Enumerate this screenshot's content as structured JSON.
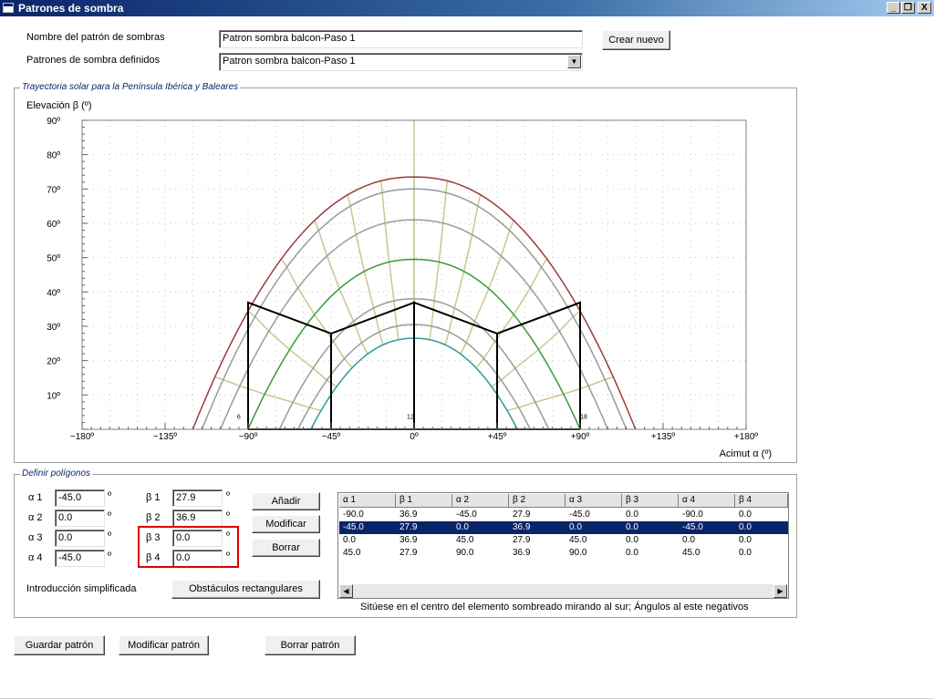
{
  "window": {
    "title": "Patrones de sombra",
    "buttons": [
      "_",
      "❐",
      "X"
    ]
  },
  "header": {
    "name_label": "Nombre del patrón de sombras",
    "name_value": "Patron sombra balcon-Paso 1",
    "defined_label": "Patrones de sombra definidos",
    "defined_value": "Patron sombra balcon-Paso 1",
    "create_button": "Crear nuevo"
  },
  "chart_group": {
    "title": "Trayectoria solar para la Península Ibérica y Baleares"
  },
  "chart_data": {
    "type": "line",
    "ylabel": "Elevación β (º)",
    "xlabel": "Acimut α (º)",
    "xlim": [
      -180,
      180
    ],
    "ylim": [
      0,
      90
    ],
    "x_ticks": [
      "−180º",
      "−135º",
      "−90º",
      "−45º",
      "0º",
      "+45º",
      "+90º",
      "+135º",
      "+180º"
    ],
    "y_ticks": [
      "10º",
      "20º",
      "30º",
      "40º",
      "50º",
      "60º",
      "70º",
      "80º",
      "90º"
    ],
    "hour_labels": [
      {
        "text": "6",
        "x": -95
      },
      {
        "text": "12",
        "x": -2
      },
      {
        "text": "18",
        "x": 92
      }
    ],
    "sun_paths": [
      {
        "peak": 73.5,
        "halfwidth": 120,
        "color": "#9b3b3b"
      },
      {
        "peak": 70,
        "halfwidth": 115,
        "color": "#9a9a9a"
      },
      {
        "peak": 61,
        "halfwidth": 105,
        "color": "#9a9a9a"
      },
      {
        "peak": 49.5,
        "halfwidth": 90,
        "color": "#3a9a3a"
      },
      {
        "peak": 38,
        "halfwidth": 73,
        "color": "#9a9a9a"
      },
      {
        "peak": 30.5,
        "halfwidth": 63,
        "color": "#9a9a9a"
      },
      {
        "peak": 26.5,
        "halfwidth": 56,
        "color": "#2a9a9a"
      }
    ],
    "hour_line_color": "#c8c890",
    "obstacle": {
      "points": [
        [
          -90,
          0
        ],
        [
          -90,
          36.9
        ],
        [
          -45,
          27.9
        ],
        [
          -45,
          0
        ],
        [
          -45,
          27.9
        ],
        [
          0,
          36.9
        ],
        [
          0,
          0
        ],
        [
          0,
          36.9
        ],
        [
          45,
          27.9
        ],
        [
          45,
          0
        ],
        [
          45,
          27.9
        ],
        [
          90,
          36.9
        ],
        [
          90,
          0
        ]
      ],
      "color": "#000000"
    }
  },
  "polygon_group": {
    "title": "Definir polígonos"
  },
  "inputs": {
    "a1_label": "α 1",
    "a1": "-45.0",
    "a2_label": "α 2",
    "a2": "0.0",
    "a3_label": "α 3",
    "a3": "0.0",
    "a4_label": "α 4",
    "a4": "-45.0",
    "b1_label": "β 1",
    "b1": "27.9",
    "b2_label": "β 2",
    "b2": "36.9",
    "b3_label": "β 3",
    "b3": "0.0",
    "b4_label": "β 4",
    "b4": "0.0",
    "degree": "º"
  },
  "buttons": {
    "add": "Añadir",
    "modify": "Modificar",
    "delete": "Borrar",
    "rect": "Obstáculos rectangulares"
  },
  "simplified_label": "Introducción simplificada",
  "table": {
    "headers": [
      "α 1",
      "β 1",
      "α 2",
      "β 2",
      "α 3",
      "β 3",
      "α 4",
      "β 4"
    ],
    "rows": [
      [
        "-90.0",
        "36.9",
        "-45.0",
        "27.9",
        "-45.0",
        "0.0",
        "-90.0",
        "0.0"
      ],
      [
        "-45.0",
        "27.9",
        "0.0",
        "36.9",
        "0.0",
        "0.0",
        "-45.0",
        "0.0"
      ],
      [
        "0.0",
        "36.9",
        "45.0",
        "27.9",
        "45.0",
        "0.0",
        "0.0",
        "0.0"
      ],
      [
        "45.0",
        "27.9",
        "90.0",
        "36.9",
        "90.0",
        "0.0",
        "45.0",
        "0.0"
      ]
    ],
    "selected_row": 1
  },
  "note": "Sitúese en el centro del elemento sombreado mirando al sur; Ángulos al este negativos",
  "footer": {
    "save": "Guardar patrón",
    "modify": "Modificar patrón",
    "delete": "Borrar patrón"
  }
}
